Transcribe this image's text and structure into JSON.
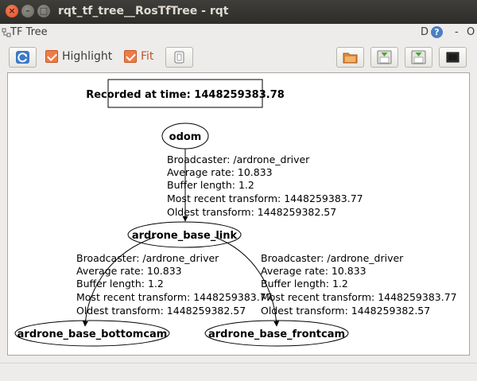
{
  "window": {
    "title": "rqt_tf_tree__RosTfTree - rqt"
  },
  "plugin": {
    "title": "TF Tree",
    "help_label": "D",
    "help_glyph": "?",
    "minimize_label": "-",
    "float_label": "O"
  },
  "toolbar": {
    "refresh_icon": "refresh-icon",
    "highlight": {
      "label": "Highlight",
      "checked": true
    },
    "fit": {
      "label": "Fit",
      "checked": true
    },
    "fit_to_view_icon": "fit-view-icon",
    "open_icon": "folder-open-icon",
    "save_dot_icon": "save-dot-icon",
    "save_svg_icon": "save-svg-icon",
    "save_image_icon": "save-image-icon"
  },
  "graph": {
    "recorded_label": "Recorded at time: 1448259383.78",
    "nodes": {
      "odom": "odom",
      "base_link": "ardrone_base_link",
      "bottomcam": "ardrone_base_bottomcam",
      "frontcam": "ardrone_base_frontcam"
    },
    "edges": {
      "odom_to_base_link": {
        "broadcaster": "Broadcaster: /ardrone_driver",
        "average_rate": "Average rate: 10.833",
        "buffer_length": "Buffer length: 1.2",
        "most_recent": "Most recent transform: 1448259383.77",
        "oldest": "Oldest transform: 1448259382.57"
      },
      "base_link_to_bottomcam": {
        "broadcaster": "Broadcaster: /ardrone_driver",
        "average_rate": "Average rate: 10.833",
        "buffer_length": "Buffer length: 1.2",
        "most_recent": "Most recent transform: 1448259383.77",
        "oldest": "Oldest transform: 1448259382.57"
      },
      "base_link_to_frontcam": {
        "broadcaster": "Broadcaster: /ardrone_driver",
        "average_rate": "Average rate: 10.833",
        "buffer_length": "Buffer length: 1.2",
        "most_recent": "Most recent transform: 1448259383.77",
        "oldest": "Oldest transform: 1448259382.57"
      }
    }
  },
  "colors": {
    "accent": "#f07a45",
    "titlebar": "#3c3b37",
    "canvas": "#ffffff"
  }
}
